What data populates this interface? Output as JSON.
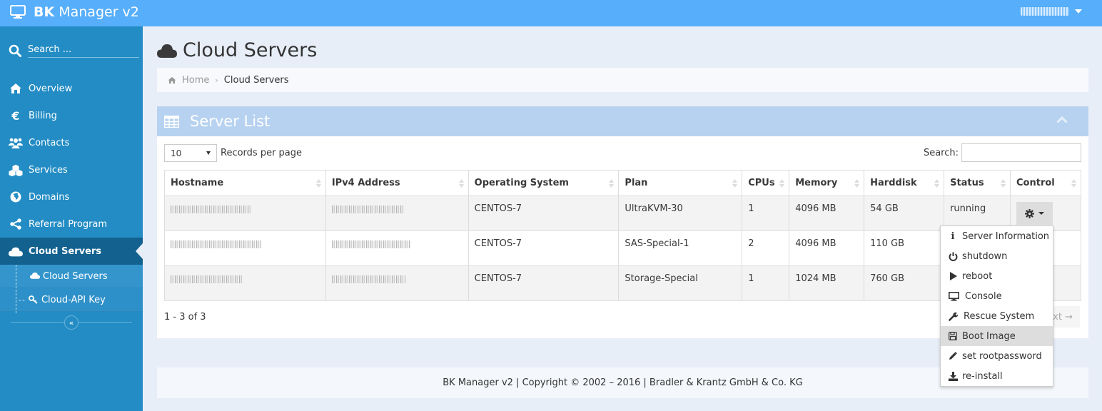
{
  "app": {
    "brand_bold": "BK",
    "brand_rest": "Manager v2",
    "user_name": "(redacted)"
  },
  "sidebar": {
    "search_placeholder": "Search ...",
    "items": [
      {
        "label": "Overview",
        "icon": "home-icon"
      },
      {
        "label": "Billing",
        "icon": "euro-icon"
      },
      {
        "label": "Contacts",
        "icon": "users-icon"
      },
      {
        "label": "Services",
        "icon": "cubes-icon"
      },
      {
        "label": "Domains",
        "icon": "globe-icon"
      },
      {
        "label": "Referral Program",
        "icon": "share-icon"
      },
      {
        "label": "Cloud Servers",
        "icon": "cloud-icon",
        "active": true
      }
    ],
    "subitems": [
      {
        "label": "Cloud Servers",
        "icon": "cloud-icon",
        "active": true
      },
      {
        "label": "Cloud-API Key",
        "icon": "key-icon"
      }
    ],
    "collapse_glyph": "«"
  },
  "page": {
    "title": "Cloud Servers",
    "breadcrumb": {
      "home": "Home",
      "current": "Cloud Servers",
      "separator": "›"
    }
  },
  "panel": {
    "title": "Server List",
    "records_per_page_value": "10",
    "records_per_page_label": "Records per page",
    "search_label": "Search:",
    "search_value": "",
    "columns": [
      "Hostname",
      "IPv4 Address",
      "Operating System",
      "Plan",
      "CPUs",
      "Memory",
      "Harddisk",
      "Status",
      "Control"
    ],
    "rows": [
      {
        "hostname": "(redacted)",
        "ipv4": "(redacted)",
        "os": "CENTOS-7",
        "plan": "UltraKVM-30",
        "cpus": "1",
        "memory": "4096 MB",
        "harddisk": "54 GB",
        "status": "running"
      },
      {
        "hostname": "(redacted)",
        "ipv4": "(redacted)",
        "os": "CENTOS-7",
        "plan": "SAS-Special-1",
        "cpus": "2",
        "memory": "4096 MB",
        "harddisk": "110 GB",
        "status": ""
      },
      {
        "hostname": "(redacted)",
        "ipv4": "(redacted)",
        "os": "CENTOS-7",
        "plan": "Storage-Special",
        "cpus": "1",
        "memory": "1024 MB",
        "harddisk": "760 GB",
        "status": ""
      }
    ],
    "info": "1 - 3 of 3",
    "next_label": "Next →"
  },
  "control_menu": {
    "items": [
      {
        "label": "Server Information",
        "icon": "info-icon"
      },
      {
        "label": "shutdown",
        "icon": "power-icon"
      },
      {
        "label": "reboot",
        "icon": "play-icon"
      },
      {
        "label": "Console",
        "icon": "monitor-icon"
      },
      {
        "label": "Rescue System",
        "icon": "wrench-icon"
      },
      {
        "label": "Boot Image",
        "icon": "save-icon",
        "hovered": true
      },
      {
        "label": "set rootpassword",
        "icon": "pencil-icon"
      },
      {
        "label": "re-install",
        "icon": "download-icon"
      }
    ]
  },
  "footer": {
    "text": "BK Manager v2 | Copyright © 2002 – 2016 | Bradler & Krantz GmbH & Co. KG"
  },
  "colors": {
    "navbar": "#57aefa",
    "sidebar": "#238cc4",
    "sidebar_active": "#12618f",
    "panel_header": "#b7d2f0",
    "background": "#e8eef8"
  }
}
